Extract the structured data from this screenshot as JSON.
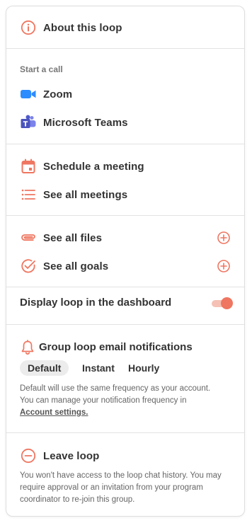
{
  "about": {
    "label": "About this loop",
    "icon": "info-icon"
  },
  "start_call": {
    "caption": "Start a call",
    "items": [
      {
        "label": "Zoom",
        "icon": "zoom-icon"
      },
      {
        "label": "Microsoft Teams",
        "icon": "teams-icon"
      }
    ]
  },
  "meetings": {
    "items": [
      {
        "label": "Schedule a meeting",
        "icon": "calendar-icon"
      },
      {
        "label": "See all meetings",
        "icon": "list-icon"
      }
    ]
  },
  "resources": {
    "items": [
      {
        "label": "See all files",
        "icon": "paperclip-icon",
        "action_icon": "plus-circle-icon"
      },
      {
        "label": "See all goals",
        "icon": "check-circle-icon",
        "action_icon": "plus-circle-icon"
      }
    ]
  },
  "dashboard": {
    "label": "Display loop in the dashboard",
    "enabled": true
  },
  "notifications": {
    "title": "Group loop email notifications",
    "icon": "bell-icon",
    "options": [
      "Default",
      "Instant",
      "Hourly"
    ],
    "selected": "Default",
    "help_text": "Default will use the same frequency as your account. You can manage your notification frequency in",
    "help_link": "Account settings."
  },
  "leave": {
    "label": "Leave loop",
    "icon": "minus-circle-icon",
    "help_text": "You won't have access to the loop chat history. You may require approval or an invitation from your program coordinator to re-join this group."
  },
  "colors": {
    "accent": "#EF7660",
    "accent_light": "#F5C1B5",
    "zoom_blue": "#2D8CFF",
    "teams_purple": "#5059C9",
    "text": "#333333",
    "muted": "#666666",
    "divider": "#E2E2E2"
  }
}
